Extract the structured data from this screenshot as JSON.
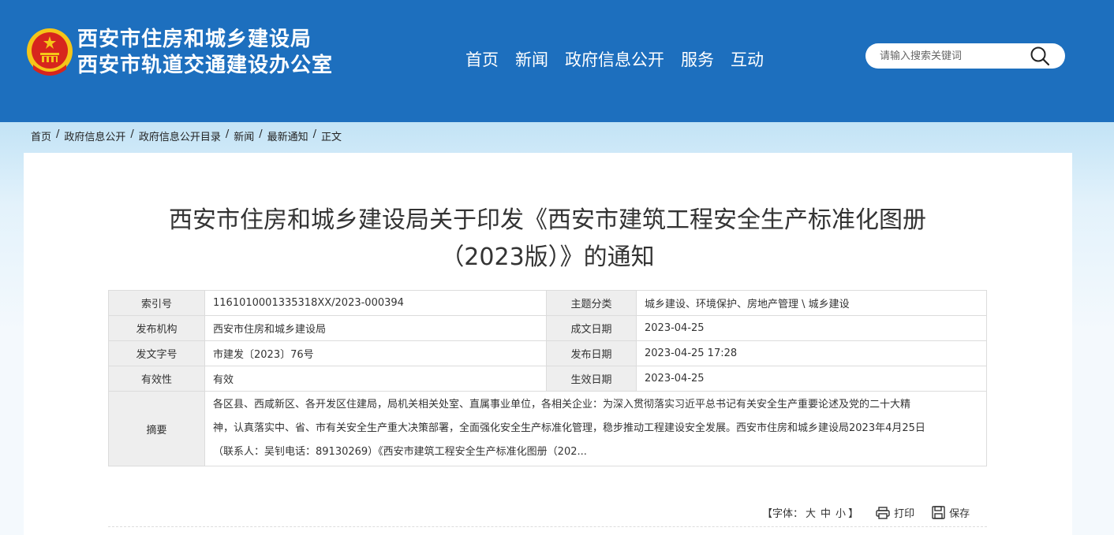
{
  "header": {
    "site_name_1": "西安市住房和城乡建设局",
    "site_name_2": "西安市轨道交通建设办公室",
    "nav": [
      "首页",
      "新闻",
      "政府信息公开",
      "服务",
      "互动"
    ],
    "search_placeholder": "请输入搜索关键词",
    "colors": {
      "brand": "#1d6fbe",
      "emblem_red": "#d7251d",
      "emblem_gold": "#f5c518"
    }
  },
  "breadcrumb": [
    "首页",
    "政府信息公开",
    "政府信息公开目录",
    "新闻",
    "最新通知",
    "正文"
  ],
  "article": {
    "title_line1": "西安市住房和城乡建设局关于印发《西安市建筑工程安全生产标准化图册",
    "title_line2": "（2023版）》的通知"
  },
  "meta": {
    "index_label": "索引号",
    "index_value": "1161010001335318XX/2023-000394",
    "topic_label": "主题分类",
    "topic_value": "城乡建设、环境保护、房地产管理 \\ 城乡建设",
    "publisher_label": "发布机构",
    "publisher_value": "西安市住房和城乡建设局",
    "created_label": "成文日期",
    "created_value": "2023-04-25",
    "docno_label": "发文字号",
    "docno_value": "市建发〔2023〕76号",
    "published_label": "发布日期",
    "published_value": "2023-04-25 17:28",
    "validity_label": "有效性",
    "validity_value": "有效",
    "effective_label": "生效日期",
    "effective_value": "2023-04-25",
    "abstract_label": "摘要",
    "abstract_line1": "各区县、西咸新区、各开发区住建局，局机关相关处室、直属事业单位，各相关企业：为深入贯彻落实习近平总书记有关安全生产重要论述及党的二十大精",
    "abstract_line2": "神，认真落实中、省、市有关安全生产重大决策部署，全面强化安全生产标准化管理，稳步推动工程建设安全发展。西安市住房和城乡建设局2023年4月25日",
    "abstract_line3": "（联系人：吴钊电话：89130269）《西安市建筑工程安全生产标准化图册（202..."
  },
  "tools": {
    "font_label_open": "【字体：",
    "font_large": "大",
    "font_medium": "中",
    "font_small": "小",
    "font_label_close": "】",
    "print_label": "打印",
    "save_label": "保存"
  }
}
